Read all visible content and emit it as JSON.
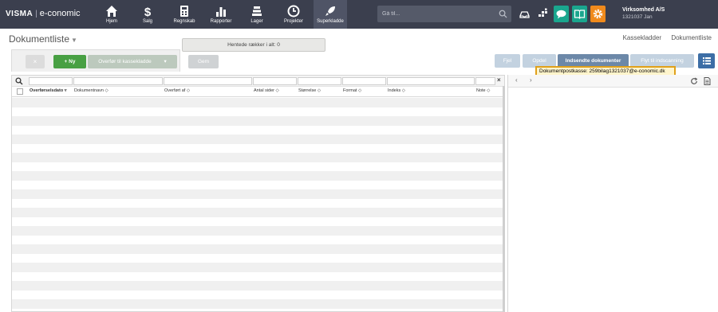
{
  "brand": {
    "visma": "VISMA",
    "separator": "|",
    "product": "e-conomic"
  },
  "nav": {
    "items": [
      {
        "label": "Hjem",
        "icon": "home-icon"
      },
      {
        "label": "Salg",
        "icon": "dollar-icon"
      },
      {
        "label": "Regnskab",
        "icon": "calculator-icon"
      },
      {
        "label": "Rapporter",
        "icon": "bar-chart-icon"
      },
      {
        "label": "Lager",
        "icon": "stack-icon"
      },
      {
        "label": "Projekter",
        "icon": "clock-icon"
      },
      {
        "label": "Superkladde",
        "icon": "rocket-icon"
      }
    ],
    "active": "Superkladde"
  },
  "search": {
    "placeholder": "Gå til..."
  },
  "toolbar_icons": {
    "inbox": {
      "icon": "inbox-icon",
      "color": "#3b3f4e"
    },
    "apps": {
      "icon": "apps-icon",
      "color": "#3b3f4e"
    },
    "chat": {
      "icon": "chat-icon",
      "color": "#1aa68e"
    },
    "book": {
      "icon": "book-icon",
      "color": "#1aa68e"
    },
    "settings": {
      "icon": "gear-icon",
      "color": "#f08a1c"
    }
  },
  "company": {
    "name": "Virksomhed A/S",
    "sub": "1321037 Jan"
  },
  "page": {
    "title": "Dokumentliste",
    "links": [
      "Kassekladder",
      "Dokumentliste"
    ],
    "loading_message": "Hentede rækker i alt: 0"
  },
  "buttons": {
    "delete": "×",
    "new": "+ Ny",
    "transfer": "Overfør til kassekladde",
    "transfer_caret": "▾",
    "save": "Gem",
    "fjern": "Fjel",
    "split": "Opdel",
    "submitted": "Indsendte dokumenter",
    "move": "Flyt til indscanning"
  },
  "tooltip": {
    "text": "Dokumentpostkasse: 259bilag1321037@e-conomic.dk"
  },
  "table": {
    "columns": [
      {
        "label": "Overførselsdato",
        "sort": "▿",
        "bold": true
      },
      {
        "label": "Dokumentnavn",
        "sort": "◇",
        "bold": false
      },
      {
        "label": "Overført af",
        "sort": "◇",
        "bold": false
      },
      {
        "label": "Antal sider",
        "sort": "◇",
        "bold": false
      },
      {
        "label": "Størrelse",
        "sort": "◇",
        "bold": false
      },
      {
        "label": "Format",
        "sort": "◇",
        "bold": false
      },
      {
        "label": "Indeks",
        "sort": "◇",
        "bold": false
      },
      {
        "label": "Note",
        "sort": "◇",
        "bold": false
      }
    ],
    "rows": []
  },
  "colors": {
    "nav_bg": "#3b3f4e",
    "accent_green": "#48a043",
    "accent_blue": "#6c88a8",
    "highlight_border": "#e0a01a"
  }
}
